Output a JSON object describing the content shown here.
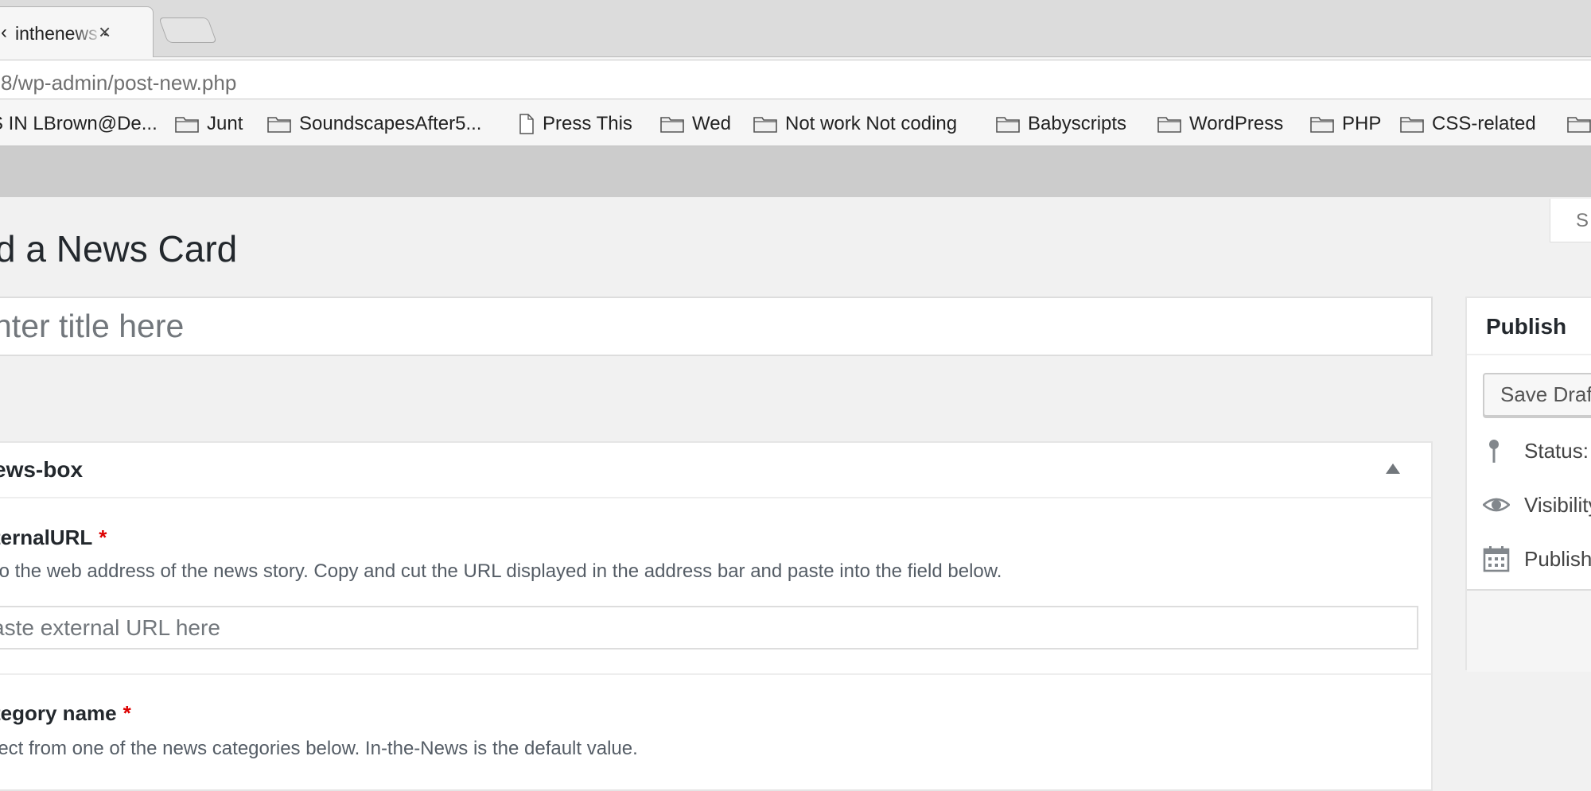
{
  "browser": {
    "tab_title": "inthenews - ",
    "tab_close": "×",
    "tab_prefix": "‹",
    "address": "8/wp-admin/post-new.php",
    "bookmarks": [
      {
        "label": "S IN LBrown@De...",
        "type": "folder"
      },
      {
        "label": "Junt",
        "type": "folder"
      },
      {
        "label": "SoundscapesAfter5...",
        "type": "folder"
      },
      {
        "label": "Press This",
        "type": "page"
      },
      {
        "label": "Wed",
        "type": "folder"
      },
      {
        "label": "Not work Not coding",
        "type": "folder"
      },
      {
        "label": "Babyscripts",
        "type": "folder"
      },
      {
        "label": "WordPress",
        "type": "folder"
      },
      {
        "label": "PHP",
        "type": "folder"
      },
      {
        "label": "CSS-related",
        "type": "folder"
      },
      {
        "label": "",
        "type": "folder"
      }
    ]
  },
  "wp": {
    "screen_options": "S",
    "page_title": "d a News Card",
    "title_placeholder": "nter title here",
    "postbox": {
      "title": "ews-box",
      "fields": [
        {
          "label": "ternalURL",
          "required": "*",
          "description": "to the web address of the news story. Copy and cut the URL displayed in the address bar and paste into the field below.",
          "placeholder": "aste external URL here"
        },
        {
          "label": "tegory name",
          "required": "*",
          "description": "lect from one of the news categories below. In-the-News is the default value."
        }
      ]
    },
    "publish": {
      "title": "Publish",
      "save_draft": "Save Draft",
      "status_label": "Status:",
      "visibility_label": "Visibility",
      "publish_label": "Publish"
    }
  },
  "colors": {
    "admin_bar": "#cccccc",
    "background": "#f1f1f1",
    "required": "#dd0000"
  }
}
